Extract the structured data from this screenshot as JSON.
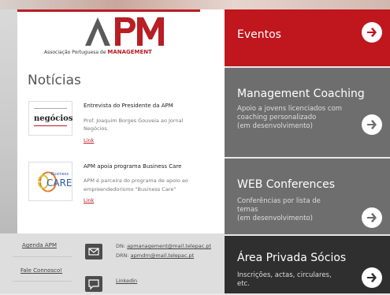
{
  "logo": {
    "text": "APM",
    "subtitle_prefix": "Associação Portuguesa de",
    "subtitle_brand": "MANAGEMENT",
    "brand_red": "#b81e24",
    "brand_gray": "#5a5a5a"
  },
  "news": {
    "heading": "Notícias",
    "items": [
      {
        "image_label": "negócios",
        "title": "Entrevista do Presidente da APM",
        "desc_lines": [
          "Prof. Joaquim Borges Gouveia ao Jornal",
          "Negócios."
        ],
        "link": "Link"
      },
      {
        "image_label_small": "Business",
        "image_label": "CARE",
        "title": "APM apoia programa Business Care",
        "desc_lines": [
          "APM é parceira do programa de apoio ao",
          "empreendedorismo \"Business Care\""
        ],
        "link": "Link"
      }
    ]
  },
  "footer": {
    "links": [
      "Agenda APM",
      "Fale Connosco!"
    ],
    "emails": [
      {
        "label": "DN:",
        "email": "apmanagement@mail.telepac.pt"
      },
      {
        "label": "DRN:",
        "email": "apmdrn@mail.telepac.pt"
      }
    ],
    "linkedin": "Linkedin"
  },
  "tiles": [
    {
      "title": "Eventos",
      "subtitle_lines": [],
      "color": "#c0161d"
    },
    {
      "title": "Management Coaching",
      "subtitle_lines": [
        "Apoio a jovens licenciados com",
        "coaching personalizado",
        "(em desenvolvimento)"
      ],
      "color": "#6e6e6e"
    },
    {
      "title": "WEB Conferences",
      "subtitle_lines": [
        "Conferências por lista de",
        "temas",
        "(em desenvolvimento)"
      ],
      "color": "#6e6e6e"
    },
    {
      "title": "Área Privada Sócios",
      "subtitle_lines": [
        "Inscrições, actas, circulares,",
        "etc."
      ],
      "color": "#2f2f2f"
    }
  ],
  "icons": {
    "arrow": "arrow-right-circle-icon",
    "mail": "mail-icon",
    "chat": "chat-icon"
  }
}
